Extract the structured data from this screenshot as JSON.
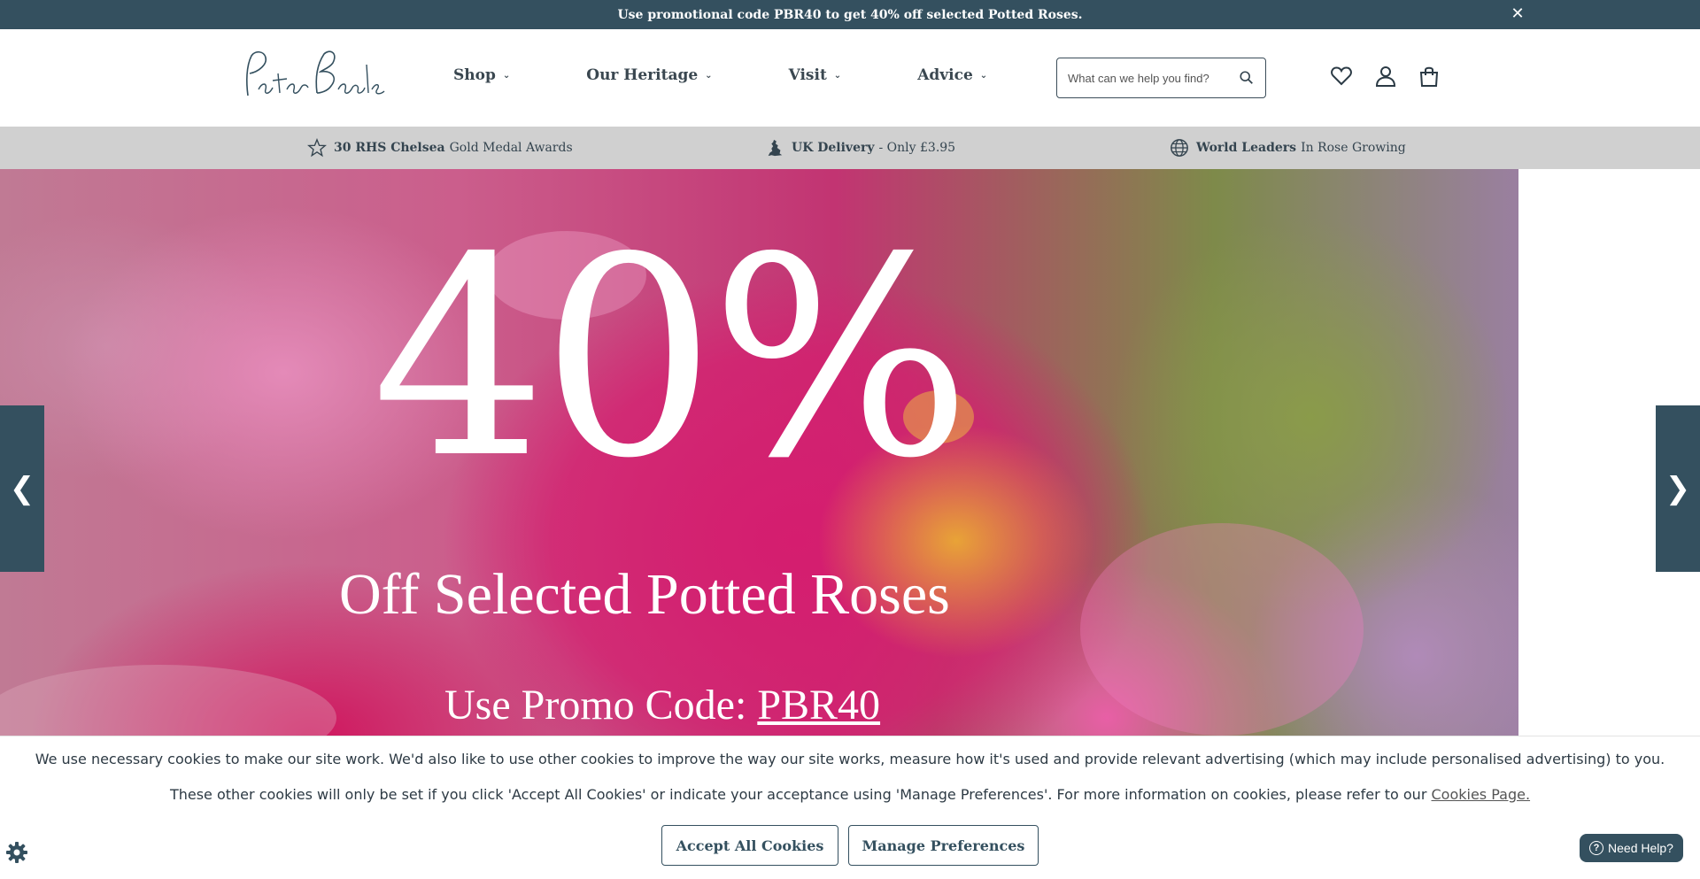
{
  "promo": {
    "text": "Use promotional code PBR40 to get 40% off selected Potted Roses.",
    "close_icon": "close-icon"
  },
  "header": {
    "logo_text": "Peter Beales",
    "nav": {
      "shop": "Shop",
      "heritage": "Our Heritage",
      "visit": "Visit",
      "advice": "Advice"
    },
    "search": {
      "placeholder": "What can we help you find?",
      "value": ""
    },
    "icons": [
      "search-icon",
      "heart-icon",
      "user-icon",
      "bag-icon"
    ]
  },
  "benefits": [
    {
      "bold": "30 RHS Chelsea",
      "text": "Gold Medal Awards",
      "icon": "star-icon"
    },
    {
      "bold": "UK Delivery",
      "text": "- Only £3.95",
      "icon": "uk-map-icon"
    },
    {
      "bold": "World Leaders",
      "text": "In Rose Growing",
      "icon": "globe-icon"
    }
  ],
  "hero": {
    "headline": "40%",
    "subline": "Off Selected Potted Roses",
    "code_prefix": "Use Promo Code:",
    "code": "PBR40"
  },
  "carousel": {
    "prev_glyph": "❮",
    "next_glyph": "❯"
  },
  "cookie": {
    "line1": "We use necessary cookies to make our site work. We'd also like to use other cookies to improve the way our site works, measure how it's used and provide relevant advertising (which may include personalised advertising) to you.",
    "line2": "These other cookies will only be set if you click 'Accept All Cookies' or indicate your acceptance using 'Manage Preferences'. For more information on cookies, please refer to our",
    "link": "Cookies Page.",
    "accept": "Accept All Cookies",
    "manage": "Manage Preferences"
  },
  "help": {
    "label": "Need Help?",
    "q": "?"
  },
  "colors": {
    "brand": "#34505f",
    "benefits_bg": "#d0d0d0"
  }
}
